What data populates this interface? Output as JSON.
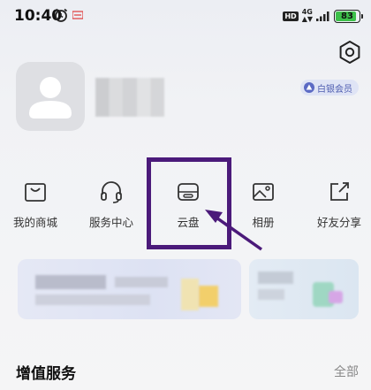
{
  "status_bar": {
    "time": "10:40",
    "network_type": "4G",
    "hd_label": "HD",
    "battery_level": "83",
    "battery_percent": 0.83
  },
  "profile": {
    "vip_badge": "白银会员"
  },
  "shortcuts": [
    {
      "label": "我的商城",
      "icon": "mall-icon"
    },
    {
      "label": "服务中心",
      "icon": "headset-icon"
    },
    {
      "label": "云盘",
      "icon": "cloud-drive-icon"
    },
    {
      "label": "相册",
      "icon": "album-icon"
    },
    {
      "label": "好友分享",
      "icon": "share-icon"
    }
  ],
  "section": {
    "title": "增值服务",
    "more": "全部"
  },
  "colors": {
    "highlight": "#4b1a7a",
    "vip_text": "#4d5cb0",
    "battery": "#3dc04a"
  }
}
